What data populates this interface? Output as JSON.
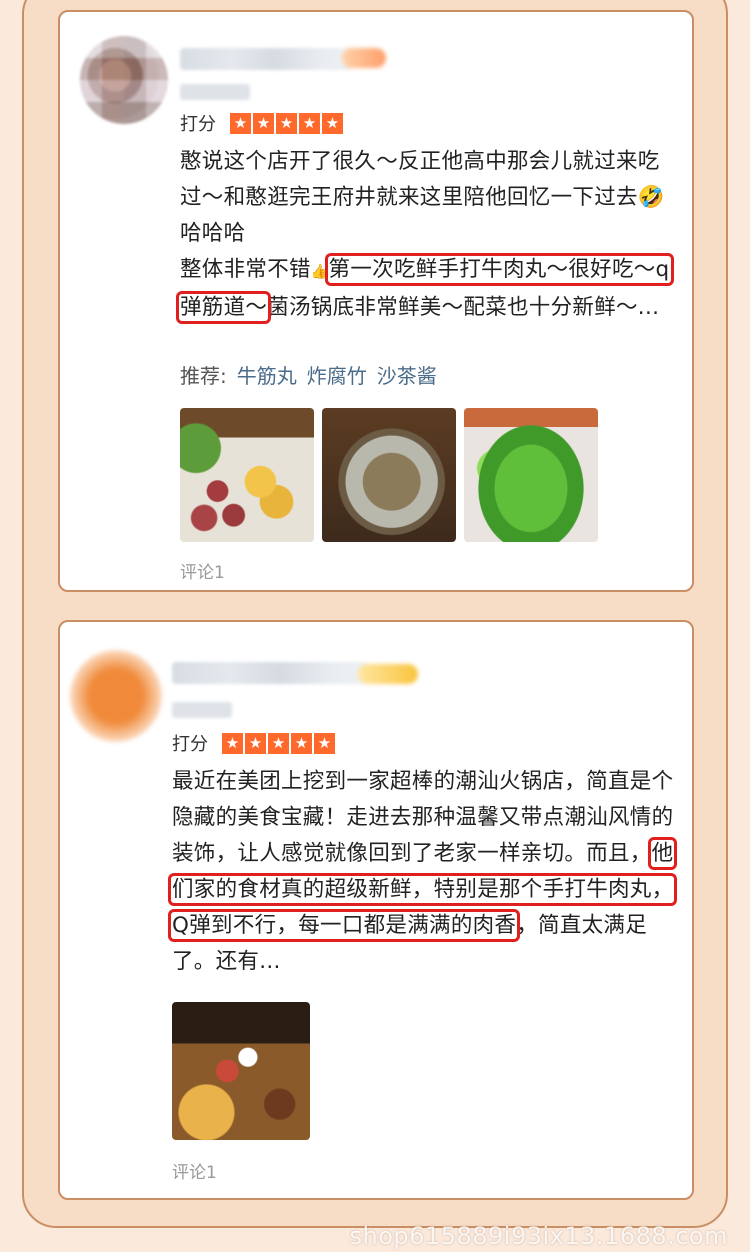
{
  "reviews": [
    {
      "rating_label": "打分",
      "stars": 5,
      "text_before": "憨说这个店开了很久～反正他高中那会儿就过来吃过～和憨逛完王府井就来这里陪他回忆一下过去",
      "emoji": "🤣",
      "text_after_emoji": "哈哈哈",
      "text_line2_prefix": "整体非常不错",
      "thumb": "👍",
      "highlight_1": "第一次吃鲜手打牛肉丸～很好吃～q弹筋道～",
      "text_after_highlight": "菌汤锅底非常鲜美～配菜也十分新鲜～...",
      "recommend_label": "推荐:",
      "recommend_dishes": [
        "牛筋丸",
        "炸腐竹",
        "沙茶酱"
      ],
      "comment_count": "评论1"
    },
    {
      "rating_label": "打分",
      "stars": 5,
      "text_before": "最近在美团上挖到一家超棒的潮汕火锅店，简直是个隐藏的美食宝藏！走进去那种温馨又带点潮汕风情的装饰，让人感觉就像回到了老家一样亲切。而且，",
      "highlight_1": "他们家的食材真的超级新鲜，特别是那个手打牛肉丸，Q弹到不行，每一口都是满满的肉香",
      "text_after_highlight": "，简直太满足了。还有...",
      "comment_count": "评论1"
    }
  ],
  "star_glyph": "★",
  "watermark": "shop615889i93ix13.1688.com",
  "colors": {
    "accent": "#ff6a2c",
    "highlight_box": "#e0201e",
    "panel_border": "#c98f63"
  }
}
